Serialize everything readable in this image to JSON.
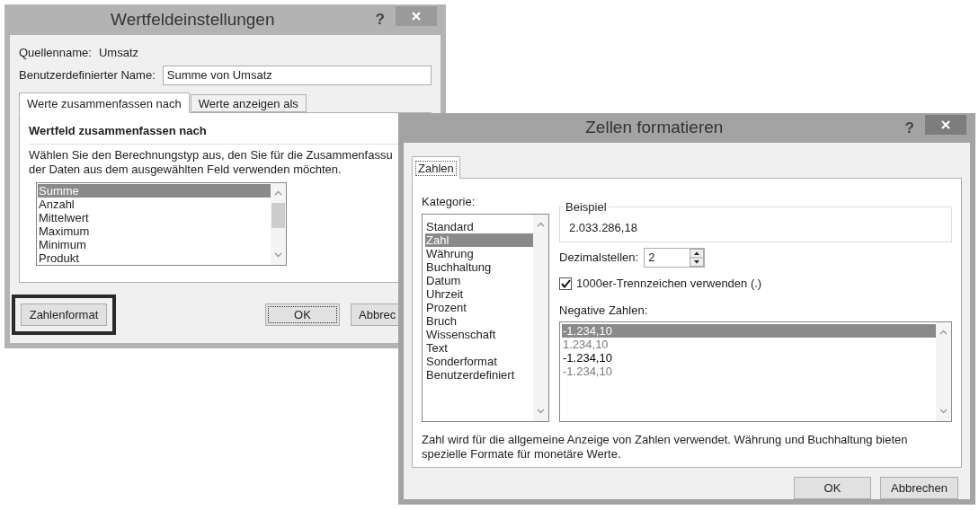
{
  "dialog_value_field": {
    "title": "Wertfeldeinstellungen",
    "help": "?",
    "source_label": "Quellenname:",
    "source_value": "Umsatz",
    "custom_name_label": "Benutzerdefinierter Name:",
    "custom_name_value": "Summe von Umsatz",
    "tabs": [
      {
        "label": "Werte zusammenfassen nach",
        "selected": true
      },
      {
        "label": "Werte anzeigen als",
        "selected": false
      }
    ],
    "heading": "Wertfeld zusammenfassen nach",
    "description_line_1": "Wählen Sie den Berechnungstyp aus, den Sie für die Zusammenfassu",
    "description_line_2": "der Daten aus dem ausgewählten Feld verwenden möchten.",
    "functions": [
      {
        "label": "Summe",
        "selected": true
      },
      {
        "label": "Anzahl",
        "selected": false
      },
      {
        "label": "Mittelwert",
        "selected": false
      },
      {
        "label": "Maximum",
        "selected": false
      },
      {
        "label": "Minimum",
        "selected": false
      },
      {
        "label": "Produkt",
        "selected": false
      }
    ],
    "number_format_button": {
      "label": "Zahlenformat",
      "highlighted": true
    },
    "ok_button": "OK",
    "cancel_button": "Abbrec"
  },
  "dialog_format_cells": {
    "title": "Zellen formatieren",
    "help": "?",
    "tabs": [
      {
        "label": "Zahlen",
        "selected": true
      }
    ],
    "category_label": "Kategorie:",
    "categories": [
      {
        "label": "Standard",
        "selected": false
      },
      {
        "label": "Zahl",
        "selected": true
      },
      {
        "label": "Währung",
        "selected": false
      },
      {
        "label": "Buchhaltung",
        "selected": false
      },
      {
        "label": "Datum",
        "selected": false
      },
      {
        "label": "Uhrzeit",
        "selected": false
      },
      {
        "label": "Prozent",
        "selected": false
      },
      {
        "label": "Bruch",
        "selected": false
      },
      {
        "label": "Wissenschaft",
        "selected": false
      },
      {
        "label": "Text",
        "selected": false
      },
      {
        "label": "Sonderformat",
        "selected": false
      },
      {
        "label": "Benutzerdefiniert",
        "selected": false
      }
    ],
    "sample_label": "Beispiel",
    "sample_value": "2.033.286,18",
    "decimals_label": "Dezimalstellen:",
    "decimals_value": "2",
    "separator": {
      "label": "1000er-Trennzeichen verwenden (.)",
      "checked": true
    },
    "negative_label": "Negative Zahlen:",
    "negative_formats": [
      {
        "label": "-1.234,10",
        "selected": true
      },
      {
        "label": "1.234,10",
        "selected": false,
        "color": "#7a7a7a"
      },
      {
        "label": "-1.234,10",
        "selected": false,
        "color": "#000000"
      },
      {
        "label": "-1.234,10",
        "selected": false,
        "color": "#7a7a7a"
      }
    ],
    "description": "Zahl wird für die allgemeine Anzeige von Zahlen verwendet. Währung und Buchhaltung bieten spezielle Formate für monetäre Werte.",
    "ok_button": "OK",
    "cancel_button": "Abbrechen"
  }
}
